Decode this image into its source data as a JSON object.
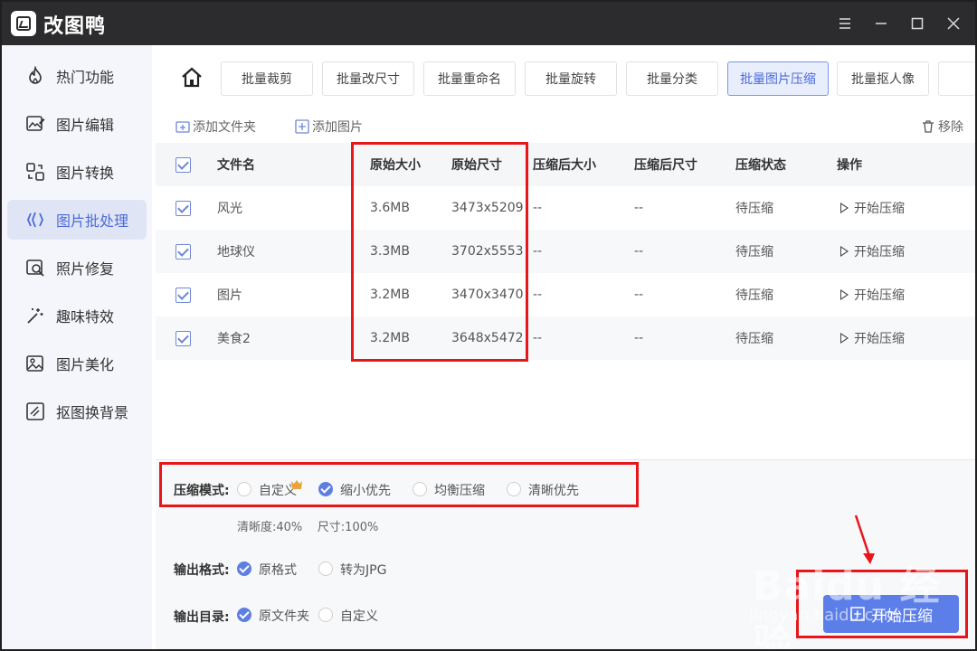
{
  "app": {
    "title": "改图鸭"
  },
  "sidebar": {
    "items": [
      {
        "label": "热门功能",
        "icon": "flame-icon"
      },
      {
        "label": "图片编辑",
        "icon": "image-edit-icon"
      },
      {
        "label": "图片转换",
        "icon": "convert-icon"
      },
      {
        "label": "图片批处理",
        "icon": "batch-icon",
        "active": true
      },
      {
        "label": "照片修复",
        "icon": "photo-repair-icon"
      },
      {
        "label": "趣味特效",
        "icon": "magic-wand-icon"
      },
      {
        "label": "图片美化",
        "icon": "image-beautify-icon"
      },
      {
        "label": "抠图换背景",
        "icon": "cutout-icon"
      }
    ]
  },
  "toolbar": {
    "tabs": [
      {
        "label": "批量裁剪"
      },
      {
        "label": "批量改尺寸"
      },
      {
        "label": "批量重命名"
      },
      {
        "label": "批量旋转"
      },
      {
        "label": "批量分类"
      },
      {
        "label": "批量图片压缩",
        "active": true
      },
      {
        "label": "批量抠人像"
      }
    ]
  },
  "actions": {
    "add_folder": "添加文件夹",
    "add_image": "添加图片",
    "remove": "移除"
  },
  "table": {
    "headers": [
      "文件名",
      "原始大小",
      "原始尺寸",
      "压缩后大小",
      "压缩后尺寸",
      "压缩状态",
      "操作"
    ],
    "rows": [
      {
        "name": "风光",
        "size": "3.6MB",
        "dims": "3473x5209",
        "new_size": "--",
        "new_dims": "--",
        "status": "待压缩",
        "action": "开始压缩"
      },
      {
        "name": "地球仪",
        "size": "3.3MB",
        "dims": "3702x5553",
        "new_size": "--",
        "new_dims": "--",
        "status": "待压缩",
        "action": "开始压缩"
      },
      {
        "name": "图片",
        "size": "3.2MB",
        "dims": "3470x3470",
        "new_size": "--",
        "new_dims": "--",
        "status": "待压缩",
        "action": "开始压缩"
      },
      {
        "name": "美食2",
        "size": "3.2MB",
        "dims": "3648x5472",
        "new_size": "--",
        "new_dims": "--",
        "status": "待压缩",
        "action": "开始压缩"
      }
    ]
  },
  "options": {
    "compress_mode_label": "压缩模式:",
    "compress_modes": [
      "自定义",
      "缩小优先",
      "均衡压缩",
      "清晰优先"
    ],
    "compress_mode_selected": "缩小优先",
    "compress_detail": "清晰度:40%    尺寸:100%",
    "output_format_label": "输出格式:",
    "output_formats": [
      "原格式",
      "转为JPG"
    ],
    "output_format_selected": "原格式",
    "output_dir_label": "输出目录:",
    "output_dirs": [
      "原文件夹",
      "自定义"
    ],
    "output_dir_selected": "原文件夹",
    "start_button": "开始压缩"
  },
  "colors": {
    "accent": "#5c7ee8",
    "annotation": "#e8161b"
  },
  "watermark": {
    "main": "Baidu 经验",
    "sub": "jingyan.baidu.com"
  }
}
